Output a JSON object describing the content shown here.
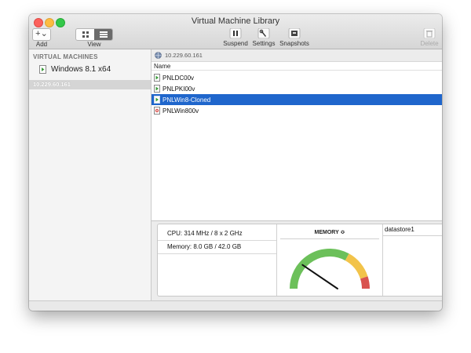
{
  "window": {
    "title": "Virtual Machine Library"
  },
  "toolbar": {
    "add_symbol": "+⌄",
    "add_label": "Add",
    "view_label": "View",
    "suspend_label": "Suspend",
    "settings_label": "Settings",
    "snapshots_label": "Snapshots",
    "delete_label": "Delete"
  },
  "sidebar": {
    "section_header": "VIRTUAL MACHINES",
    "vm_item": "Windows 8.1 x64",
    "host_item": "10.229.60.161"
  },
  "content": {
    "host_address": "10.229.60.161",
    "column_name": "Name",
    "vms": [
      {
        "name": "PNLDC00v",
        "status": "running"
      },
      {
        "name": "PNLPKI00v",
        "status": "running"
      },
      {
        "name": "PNLWin8-Cloned",
        "status": "running",
        "selected": true
      },
      {
        "name": "PNLWin800v",
        "status": "stopped"
      }
    ]
  },
  "details": {
    "cpu": "CPU: 314 MHz / 8 x 2 GHz",
    "memory": "Memory: 8.0 GB / 42.0 GB",
    "gauge_title": "MEMORY ≎",
    "gauge_value_fraction": 0.19,
    "datastore": "datastore1"
  },
  "colors": {
    "selection": "#1f66cc",
    "gauge_green": "#6cc05a",
    "gauge_yellow": "#f2c34a",
    "gauge_red": "#d9534f"
  }
}
